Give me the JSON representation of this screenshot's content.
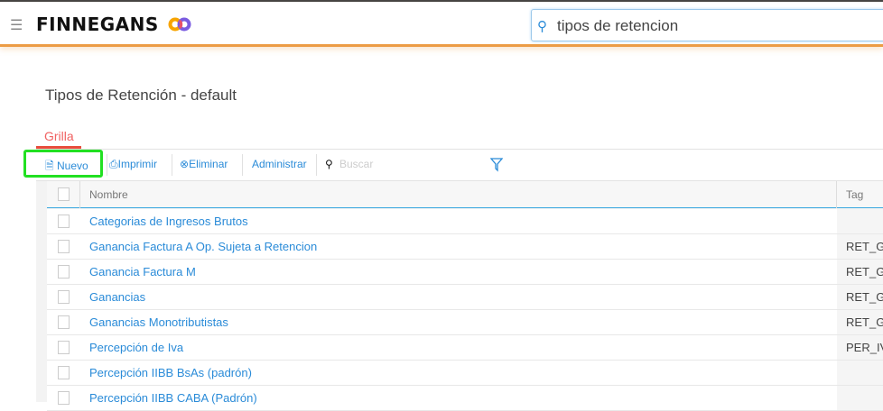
{
  "header": {
    "brand": "FINNEGANS",
    "search_value": "tipos de retencion"
  },
  "page_title": "Tipos de Retención - default",
  "tab": "Grilla",
  "toolbar": {
    "nuevo": "Nuevo",
    "imprimir": "Imprimir",
    "eliminar": "Eliminar",
    "administrar": "Administrar",
    "buscar_placeholder": "Buscar"
  },
  "columns": {
    "nombre": "Nombre",
    "tag": "Tag"
  },
  "rows": [
    {
      "nombre": "Categorias de Ingresos Brutos",
      "tag": ""
    },
    {
      "nombre": "Ganancia Factura A Op. Sujeta a Retencion",
      "tag": "RET_G"
    },
    {
      "nombre": "Ganancia Factura M",
      "tag": "RET_G"
    },
    {
      "nombre": "Ganancias",
      "tag": "RET_G"
    },
    {
      "nombre": "Ganancias Monotributistas",
      "tag": "RET_G"
    },
    {
      "nombre": "Percepción de Iva",
      "tag": "PER_IV"
    },
    {
      "nombre": "Percepción IIBB BsAs (padrón)",
      "tag": ""
    },
    {
      "nombre": "Percepción IIBB CABA (Padrón)",
      "tag": ""
    }
  ]
}
